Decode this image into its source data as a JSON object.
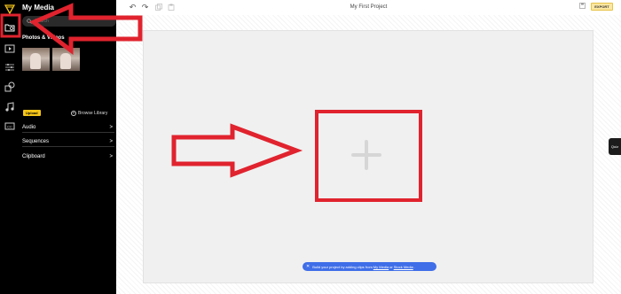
{
  "sidebar": {
    "title": "My Media",
    "search_placeholder": "Search",
    "section_title": "Photos & Videos",
    "upload_label": "Upload",
    "browse_label": "Browse Library",
    "categories": [
      {
        "label": "Audio",
        "chevron": ">"
      },
      {
        "label": "Sequences",
        "chevron": ">"
      },
      {
        "label": "Clipboard",
        "chevron": ">"
      }
    ],
    "collapse_glyph": "◀"
  },
  "topbar": {
    "project_title": "My First Project",
    "undo_glyph": "↶",
    "redo_glyph": "↷",
    "export_label": "EXPORT"
  },
  "canvas": {
    "toast": {
      "close_glyph": "✕",
      "prefix": "Build your project by adding clips from",
      "link1": "My Media",
      "mid": "or",
      "link2": "Stock Media",
      "suffix": "."
    },
    "side_tab_label": "Quiz"
  },
  "colors": {
    "annotation_red": "#e0232e",
    "export_bg": "#fbe7a0",
    "upload_bg": "#f5c518",
    "toast_bg": "#3f6ee8"
  },
  "icons": [
    "logo-icon",
    "media-folder-icon",
    "video-icon",
    "adjust-icon",
    "shapes-icon",
    "music-icon",
    "captions-icon",
    "search-icon",
    "plus-icon"
  ]
}
